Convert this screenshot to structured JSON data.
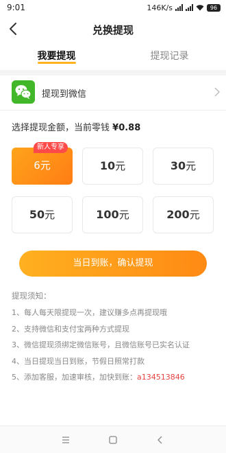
{
  "status_bar": {
    "time": "9:01",
    "network_speed": "146K/s",
    "battery": "96"
  },
  "header": {
    "title": "兑换提现"
  },
  "tabs": [
    {
      "label": "我要提现",
      "active": true
    },
    {
      "label": "提现记录",
      "active": false
    }
  ],
  "withdraw_method": {
    "label": "提现到微信",
    "icon": "wechat-icon",
    "icon_color": "#42b72a"
  },
  "amount_section": {
    "prompt": "选择提现金额，当前零钱",
    "balance": "¥0.88",
    "options": [
      {
        "value": "6",
        "unit": "元",
        "selected": true,
        "badge": "新人专享"
      },
      {
        "value": "10",
        "unit": "元",
        "selected": false,
        "badge": ""
      },
      {
        "value": "30",
        "unit": "元",
        "selected": false,
        "badge": ""
      },
      {
        "value": "50",
        "unit": "元",
        "selected": false,
        "badge": ""
      },
      {
        "value": "100",
        "unit": "元",
        "selected": false,
        "badge": ""
      },
      {
        "value": "200",
        "unit": "元",
        "selected": false,
        "badge": ""
      }
    ]
  },
  "confirm_button": {
    "label": "当日到账，确认提现"
  },
  "notes": {
    "title": "提现须知：",
    "items": [
      {
        "text": "1、每人每天限提现一次，建议赚多点再提现哦",
        "highlight": ""
      },
      {
        "text": "2、支持微信和支付宝两种方式提现",
        "highlight": ""
      },
      {
        "text": "3、微信提现须绑定微信账号，且微信账号已实名认证",
        "highlight": ""
      },
      {
        "text": "4、当日提现当日到账，节假日照常打款",
        "highlight": ""
      },
      {
        "text": "5、添加客服，加速审核，加快到账：",
        "highlight": "a134513846"
      }
    ]
  },
  "colors": {
    "accent": "#ffa41b",
    "accent_end": "#ff7d14",
    "badge": "#ff4a4a",
    "highlight": "#e8423f",
    "wechat": "#42b72a"
  }
}
